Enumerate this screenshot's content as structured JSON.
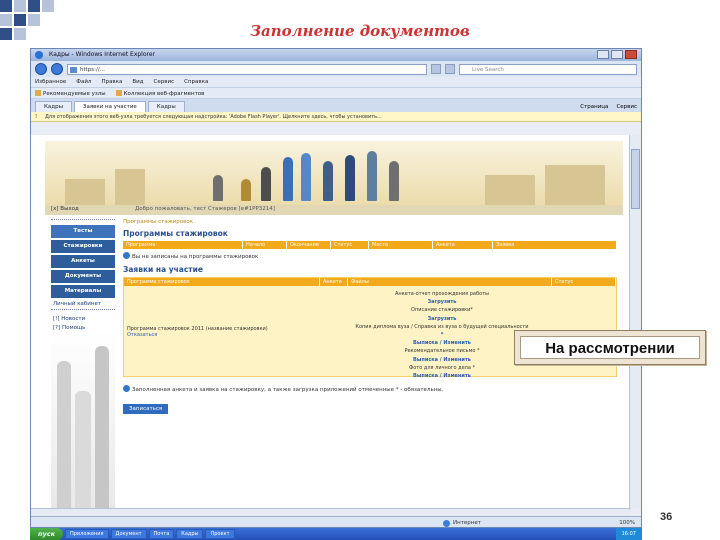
{
  "slide": {
    "title": "Заполнение документов",
    "callout": "На рассмотрении",
    "page_number": "36"
  },
  "browser": {
    "window_title": "Кадры - Windows Internet Explorer",
    "url": "https://...",
    "search_placeholder": "Live Search",
    "menu": [
      "Избранное",
      "Файл",
      "Правка",
      "Вид",
      "Сервис",
      "Справка"
    ],
    "favorites": [
      "Рекомендуемые узлы",
      "Коллекция веб-фрагментов"
    ],
    "tabs": [
      "Кадры",
      "Заявки на участие",
      "Кадры"
    ],
    "toolbar": [
      "Страница",
      "Сервис"
    ],
    "infobar": "Для отображения этого веб-узла требуется следующая надстройка: 'Adobe Flash Player'. Щелкните здесь, чтобы установить...",
    "status_zone": "Интернет",
    "zoom": "100%"
  },
  "site": {
    "header_logout": "[x] Выход",
    "greeting": "Добро пожаловать, тест Стажеров [e#1РР3214]",
    "sidebar": [
      "Тесты",
      "Стажировки",
      "Анкеты",
      "Документы",
      "Материалы",
      "Личный кабинет"
    ],
    "sidebar_extra": [
      "[!] Новости",
      "[?] Помощь"
    ],
    "breadcrumb": "Программы стажировок",
    "section_title": "Программы стажировок",
    "programs_columns": [
      "Программа",
      "Начало",
      "Окончание",
      "Статус",
      "Места",
      "Анкета",
      "Заявка"
    ],
    "programs_note": "Вы не записаны на программы стажировок",
    "applications_title": "Заявки на участие",
    "applications_columns": [
      "Программа стажировок",
      "Анкета",
      "Файлы",
      "Статус"
    ],
    "program_name": "Программа стажировок 2011 (название стажировки)",
    "program_link": "Отказаться",
    "documents": [
      {
        "text": "Анкета-отчет прохождения работы",
        "link": "Загрузить"
      },
      {
        "text": "Описание стажировки*",
        "link": "Загрузить"
      },
      {
        "text": "Копия диплома вуза / Справка из вуза о будущей специальности",
        "link": "*"
      },
      {
        "text": "",
        "link": "Выписка / Изменить"
      },
      {
        "text": "Рекомендательное письмо *",
        "link": "Выписка / Изменить"
      },
      {
        "text": "Фото для личного дела *",
        "link": "Выписка / Изменить"
      }
    ],
    "bottom_note": "Заполненная анкета и заявка на стажировку, а также загрузка приложений отмеченные * - обязательны.",
    "apply_button": "Записаться"
  },
  "taskbar": {
    "start": "пуск",
    "items": [
      "Приложения",
      "Документ",
      "Почта",
      "Кадры",
      "Проект"
    ],
    "clock": "16:07"
  }
}
